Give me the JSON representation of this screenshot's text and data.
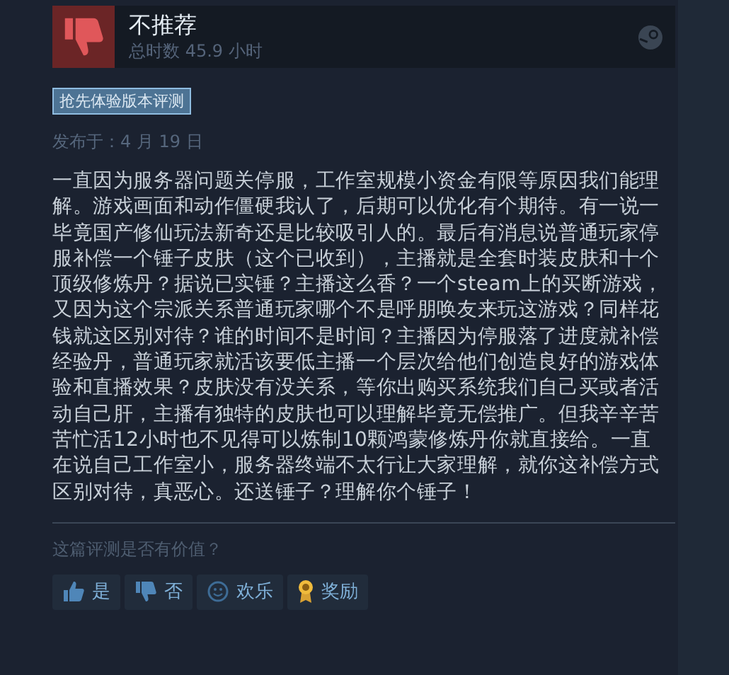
{
  "review": {
    "verdict": "不推荐",
    "recommended": false,
    "playtime": "总时数 45.9 小时",
    "badge": "抢先体验版本评测",
    "posted": "发布于：4 月 19 日",
    "body": "一直因为服务器问题关停服，工作室规模小资金有限等原因我们能理解。游戏画面和动作僵硬我认了，后期可以优化有个期待。有一说一毕竟国产修仙玩法新奇还是比较吸引人的。最后有消息说普通玩家停服补偿一个锤子皮肤（这个已收到），主播就是全套时装皮肤和十个顶级修炼丹？据说已实锤？主播这么香？一个steam上的买断游戏，又因为这个宗派关系普通玩家哪个不是呼朋唤友来玩这游戏？同样花钱就这区别对待？谁的时间不是时间？主播因为停服落了进度就补偿经验丹，普通玩家就活该要低主播一个层次给他们创造良好的游戏体验和直播效果？皮肤没有没关系，等你出购买系统我们自己买或者活动自己肝，主播有独特的皮肤也可以理解毕竟无偿推广。但我辛辛苦苦忙活12小时也不见得可以炼制10颗鸿蒙修炼丹你就直接给。一直在说自己工作室小，服务器终端不太行让大家理解，就你这补偿方式区别对待，真恶心。还送锤子？理解你个锤子！"
  },
  "helpful": {
    "question": "这篇评测是否有价值？",
    "buttons": [
      {
        "kind": "yes",
        "label": "是"
      },
      {
        "kind": "no",
        "label": "否"
      },
      {
        "kind": "funny",
        "label": "欢乐"
      },
      {
        "kind": "award",
        "label": "奖励"
      }
    ]
  }
}
